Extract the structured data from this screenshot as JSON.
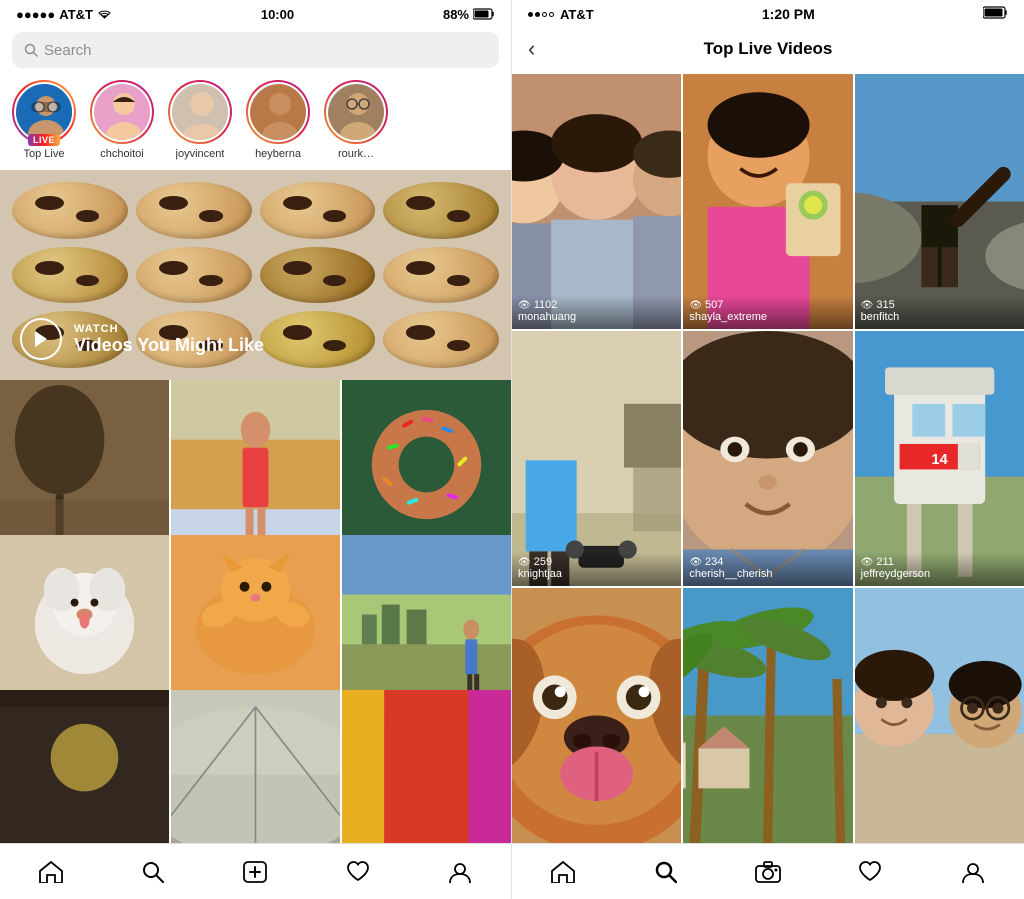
{
  "left": {
    "statusBar": {
      "carrier": "●●●●● AT&T",
      "wifi": "WiFi",
      "time": "10:00",
      "battery": "88%"
    },
    "search": {
      "placeholder": "Search"
    },
    "stories": [
      {
        "id": "top-live",
        "label": "Top Live",
        "isLive": true,
        "avatarClass": "av-blue"
      },
      {
        "id": "chchoitoi",
        "label": "chchoitoi",
        "isLive": false,
        "avatarClass": "av-pink"
      },
      {
        "id": "joyvincent",
        "label": "joyvincent",
        "isLive": false,
        "avatarClass": "av-gray"
      },
      {
        "id": "heyberna",
        "label": "heyberna",
        "isLive": false,
        "avatarClass": "av-orange"
      },
      {
        "id": "rourke",
        "label": "rourk…",
        "isLive": false,
        "avatarClass": "av-tan"
      }
    ],
    "liveBadge": "LIVE",
    "hero": {
      "watchLabel": "WATCH",
      "title": "Videos You Might Like"
    },
    "nav": {
      "items": [
        "home",
        "search",
        "add",
        "heart",
        "profile"
      ]
    }
  },
  "right": {
    "statusBar": {
      "carrier": "●●○○ AT&T",
      "time": "1:20 PM",
      "battery": "full"
    },
    "header": {
      "backLabel": "‹",
      "title": "Top Live Videos"
    },
    "liveVideos": [
      {
        "id": "monahuang",
        "username": "monahuang",
        "views": "1102",
        "bgClass": "bg-group-selfie"
      },
      {
        "id": "shayla_extreme",
        "username": "shayla_extreme",
        "views": "507",
        "bgClass": "bg-smiling"
      },
      {
        "id": "benfitch",
        "username": "benfitch",
        "views": "315",
        "bgClass": "bg-coast"
      },
      {
        "id": "knightjaa",
        "username": "knightjaa",
        "views": "259",
        "bgClass": "bg-room"
      },
      {
        "id": "cherish__cherish",
        "username": "cherish__cherish",
        "views": "234",
        "bgClass": "bg-selfie2"
      },
      {
        "id": "jeffreydgerson",
        "username": "jeffreydgerson",
        "views": "211",
        "bgClass": "bg-lifeguard"
      },
      {
        "id": "dog-video",
        "username": "",
        "views": "",
        "bgClass": "bg-dog"
      },
      {
        "id": "palms-video",
        "username": "",
        "views": "",
        "bgClass": "bg-palms"
      },
      {
        "id": "beach-group",
        "username": "",
        "views": "",
        "bgClass": "bg-beach-group"
      }
    ],
    "nav": {
      "items": [
        "home",
        "search",
        "camera",
        "heart",
        "profile"
      ]
    }
  }
}
